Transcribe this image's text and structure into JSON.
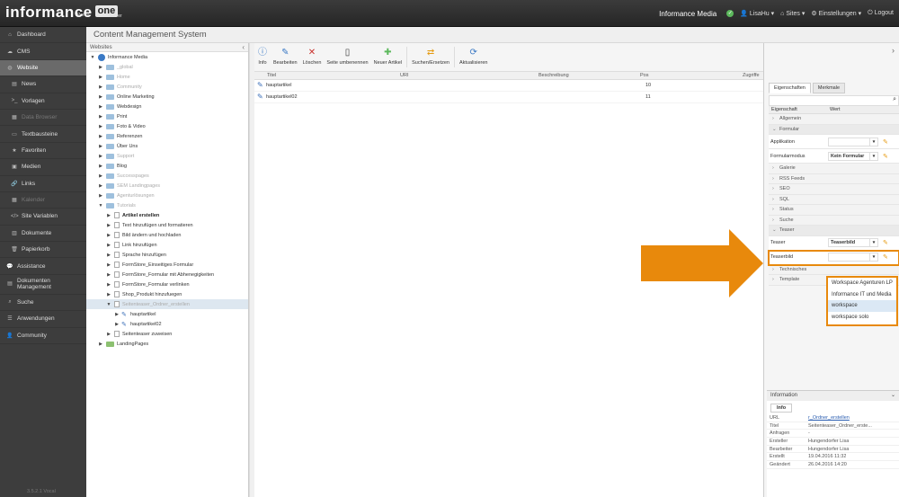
{
  "app": {
    "logo_main": "informance",
    "logo_one": "one",
    "logo_portal": "Portal",
    "logo_server": "Server"
  },
  "topbar": {
    "org": "Informance Media",
    "user": "LisaHu",
    "sites": "Sites",
    "settings": "Einstellungen",
    "logout": "Logout"
  },
  "sidebar": {
    "items": [
      {
        "label": "Dashboard",
        "icon": "home-icon"
      },
      {
        "label": "CMS",
        "icon": "cloud-icon"
      },
      {
        "label": "Website",
        "icon": "globe-icon"
      },
      {
        "label": "News",
        "icon": "news-icon"
      },
      {
        "label": "Vorlagen",
        "icon": "terminal-icon"
      },
      {
        "label": "Data Browser",
        "icon": "table-icon"
      },
      {
        "label": "Textbausteine",
        "icon": "text-icon"
      },
      {
        "label": "Favoriten",
        "icon": "star-icon"
      },
      {
        "label": "Medien",
        "icon": "image-icon"
      },
      {
        "label": "Links",
        "icon": "link-icon"
      },
      {
        "label": "Kalender",
        "icon": "calendar-icon"
      },
      {
        "label": "Site Variablen",
        "icon": "code-icon"
      },
      {
        "label": "Dokumente",
        "icon": "docs-icon"
      },
      {
        "label": "Papierkorb",
        "icon": "trash-icon"
      },
      {
        "label": "Assistance",
        "icon": "chat-icon"
      },
      {
        "label": "Dokumenten Management",
        "icon": "folder-icon"
      },
      {
        "label": "Suche",
        "icon": "search-icon"
      },
      {
        "label": "Anwendungen",
        "icon": "list-icon"
      },
      {
        "label": "Community",
        "icon": "user-icon"
      }
    ],
    "version": "3.5.2.1 Vocal"
  },
  "page_title": "Content Management System",
  "tree": {
    "header": "Websites",
    "root": "Informance Media",
    "items": [
      "_global",
      "Home",
      "Community",
      "Online Marketing",
      "Webdesign",
      "Print",
      "Foto & Video",
      "Referenzen",
      "Über Uns",
      "Support",
      "Blog",
      "Successpages",
      "SEM Landingpages",
      "Agenturlösungen",
      "Tutorials",
      "Artikel erstellen",
      "Text hinzufügen und formatieren",
      "Bild ändern und hochladen",
      "Link hinzufügen",
      "Sprache hinzufügen",
      "FormStore_Einseitiges Formular",
      "FormStore_Formular mit Abhenegigkeiten",
      "FormStore_Formular verlinken",
      "Shop_Produkt hinzufuegen",
      "Seitenteaser_Ordner_erstellen",
      "hauptartikel",
      "hauptartikel02",
      "Seitenteaser zuweisen",
      "LandingPages"
    ]
  },
  "toolbar": {
    "info": "Info",
    "edit": "Bearbeiten",
    "delete": "Löschen",
    "rename": "Seite umbenennen",
    "new": "Neuer Artikel",
    "search_replace": "Suchen/Ersetzen",
    "refresh": "Aktualisieren"
  },
  "grid": {
    "headers": {
      "title": "Titel",
      "uri": "URI",
      "description": "Beschreibung",
      "pos": "Pos",
      "access": "Zugriffe"
    },
    "rows": [
      {
        "title": "hauptartikel",
        "pos": "10"
      },
      {
        "title": "hauptartikel02",
        "pos": "11"
      }
    ]
  },
  "props": {
    "tabs": [
      "Eigenschaften",
      "Merkmale"
    ],
    "col_property": "Eigenschaft",
    "col_value": "Wert",
    "groups": {
      "allgemein": "Allgemein",
      "formular": "Formular",
      "galerie": "Galerie",
      "rss": "RSS Feeds",
      "seo": "SEO",
      "sql": "SQL",
      "status": "Status",
      "suche": "Suche",
      "teaser": "Teaser",
      "technisches": "Technisches",
      "template": "Template"
    },
    "fields": {
      "applikation": "Applikation",
      "formularmodus": "Formularmodus",
      "formularmodus_value": "Kein Formular",
      "teaser": "Teaser",
      "teaser_value": "Teaserbild",
      "teaserbild": "Teaserbild"
    },
    "dropdown_options": [
      "Workspace Agenturen LP",
      "Informance IT und Media",
      "workspace",
      "workspace solo"
    ]
  },
  "info": {
    "header": "Information",
    "tab": "Info",
    "rows": [
      {
        "k": "URL",
        "v": "r_Ordner_erstellen"
      },
      {
        "k": "Titel",
        "v": "Seitenteaser_Ordner_erste..."
      },
      {
        "k": "Anfragen",
        "v": "-"
      },
      {
        "k": "Ersteller",
        "v": "Hungendorfer Lisa"
      },
      {
        "k": "Bearbeiter",
        "v": "Hungendorfer Lisa"
      },
      {
        "k": "Erstellt",
        "v": "19.04.2016 11:32"
      },
      {
        "k": "Geändert",
        "v": "26.04.2016 14:20"
      }
    ]
  },
  "colors": {
    "accent": "#e8890c",
    "sidebar": "#3d3d3d",
    "active": "#6a6a6a"
  }
}
